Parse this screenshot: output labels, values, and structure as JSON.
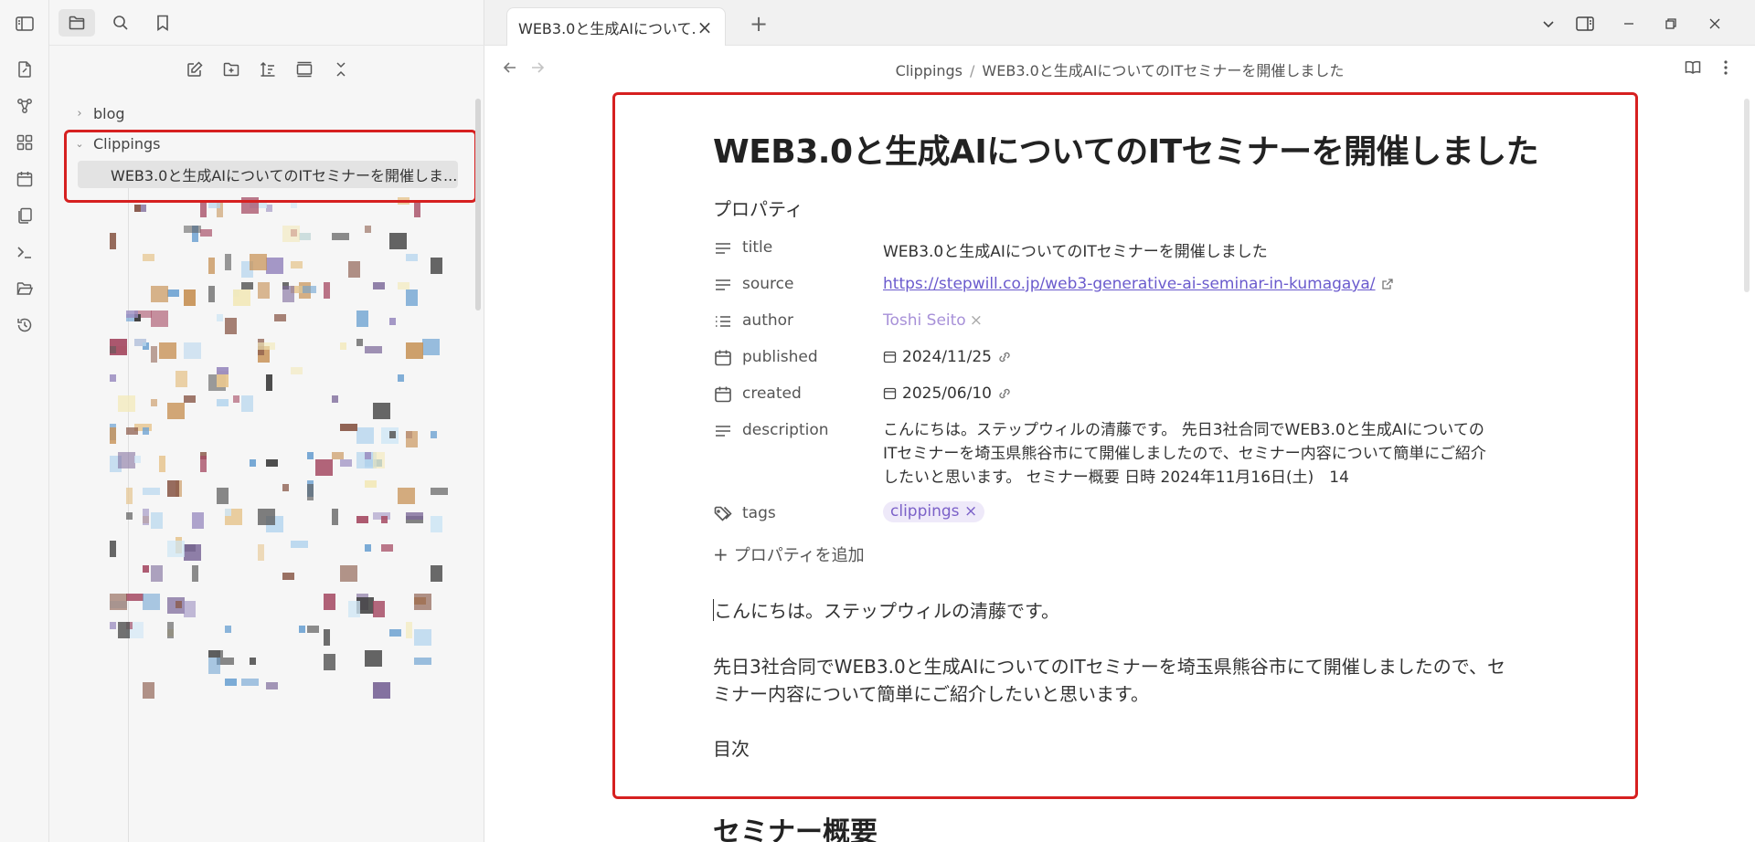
{
  "sidebar": {
    "folders": [
      {
        "label": "blog",
        "expanded": false
      },
      {
        "label": "Clippings",
        "expanded": true
      }
    ],
    "active_file": "WEB3.0と生成AIについてのITセミナーを開催しま..."
  },
  "tab": {
    "title": "WEB3.0と生成AIについて...",
    "close": "×",
    "new": "+"
  },
  "breadcrumb": {
    "folder": "Clippings",
    "separator": "/",
    "file": "WEB3.0と生成AIについてのITセミナーを開催しました"
  },
  "note": {
    "title": "WEB3.0と生成AIについてのITセミナーを開催しました",
    "properties_heading": "プロパティ",
    "properties": [
      {
        "key": "title",
        "icon": "text-lines-icon",
        "value": "WEB3.0と生成AIについてのITセミナーを開催しました"
      },
      {
        "key": "source",
        "icon": "text-lines-icon",
        "value": "https://stepwill.co.jp/web3-generative-ai-seminar-in-kumagaya/"
      },
      {
        "key": "author",
        "icon": "list-icon",
        "value": "Toshi Seito"
      },
      {
        "key": "published",
        "icon": "calendar-icon",
        "value": "2024/11/25"
      },
      {
        "key": "created",
        "icon": "calendar-icon",
        "value": "2025/06/10"
      },
      {
        "key": "description",
        "icon": "text-lines-icon",
        "value": "こんにちは。ステップウィルの清藤です。 先日3社合同でWEB3.0と生成AIについてのITセミナーを埼玉県熊谷市にて開催しましたので、セミナー内容について簡単にご紹介したいと思います。 セミナー概要 日時 2024年11月16日(土)　14"
      },
      {
        "key": "tags",
        "icon": "tags-icon",
        "value": "clippings"
      }
    ],
    "remove_mark": "×",
    "add_property": "プロパティを追加",
    "add_plus": "+",
    "body": [
      "こんにちは。ステップウィルの清藤です。",
      "先日3社合同でWEB3.0と生成AIについてのITセミナーを埼玉県熊谷市にて開催しましたので、セミナー内容について簡単にご紹介したいと思います。",
      "目次"
    ],
    "heading2": "セミナー概要"
  },
  "colors": {
    "highlight": "#d62020",
    "link": "#6a5acd",
    "tag_bg": "#eee9f9",
    "tag_text": "#7b61c8"
  }
}
